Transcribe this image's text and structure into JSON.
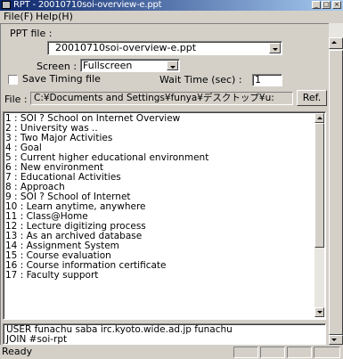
{
  "window": {
    "title": "RPT - 20010710soi-overview-e.ppt",
    "minimize_glyph": "_",
    "maximize_glyph": "□",
    "close_glyph": "×"
  },
  "menu": {
    "file": "File(F)",
    "help": "Help(H)"
  },
  "form": {
    "ppt_file_label": "PPT file :",
    "ppt_file_value": "20010710soi-overview-e.ppt",
    "screen_label": "Screen :",
    "screen_value": "Fullscreen",
    "save_timing_label": "Save Timing file",
    "save_timing_checked": false,
    "wait_time_label": "Wait Time (sec) :",
    "wait_time_value": "1",
    "file_label": "File :",
    "file_path": "C:¥Documents and Settings¥funya¥デスクトップ¥u:",
    "ref_button": "Ref."
  },
  "slides": [
    "1 : SOI ? School on Internet Overview",
    "2 : University was ..",
    "3 : Two Major Activities",
    "4 : Goal",
    "5 : Current higher educational environment",
    "6 : New environment",
    "7 : Educational Activities",
    "8 : Approach",
    "9 : SOI ? School of Internet",
    "10 : Learn anytime, anywhere",
    "11 : Class@Home",
    "12 : Lecture digitizing process",
    "13 : As an archived database",
    "14 : Assignment System",
    "15 : Course evaluation",
    "16 : Course information certificate",
    "17 : Faculty support"
  ],
  "log_lines": [
    "USER funachu saba irc.kyoto.wide.ad.jp funachu",
    "JOIN #soi-rpt"
  ],
  "status": {
    "text": "Ready"
  }
}
